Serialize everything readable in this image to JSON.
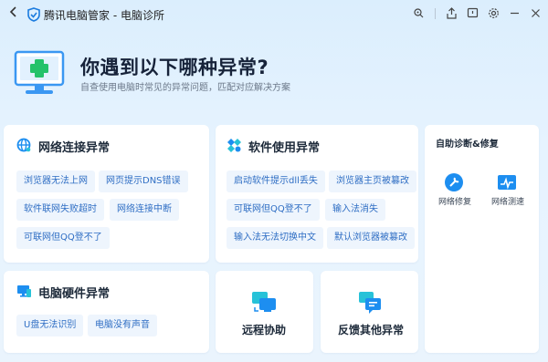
{
  "window": {
    "title": "腾讯电脑管家 - 电脑诊所"
  },
  "hero": {
    "title": "你遇到以下哪种异常?",
    "subtitle": "自查使用电脑时常见的异常问题，匹配对应解决方案"
  },
  "network": {
    "title": "网络连接异常",
    "items": [
      "浏览器无法上网",
      "网页提示DNS错误",
      "软件联网失败超时",
      "网络连接中断",
      "可联网但QQ登不了"
    ]
  },
  "software": {
    "title": "软件使用异常",
    "items": [
      "启动软件提示dll丢失",
      "浏览器主页被篡改",
      "可联网但QQ登不了",
      "输入法消失",
      "输入法无法切换中文",
      "默认浏览器被篡改"
    ]
  },
  "hardware": {
    "title": "电脑硬件异常",
    "items": [
      "U盘无法识别",
      "电脑没有声音"
    ]
  },
  "remote": {
    "label": "远程协助"
  },
  "feedback": {
    "label": "反馈其他异常"
  },
  "tools": {
    "title": "自助诊断&修复",
    "items": [
      "网络修复",
      "网络测速"
    ]
  },
  "colors": {
    "accent": "#2f6ec4",
    "chip_bg": "#eef5fd",
    "icon_blue": "#1d8ef0",
    "icon_cyan": "#27c2d8"
  }
}
